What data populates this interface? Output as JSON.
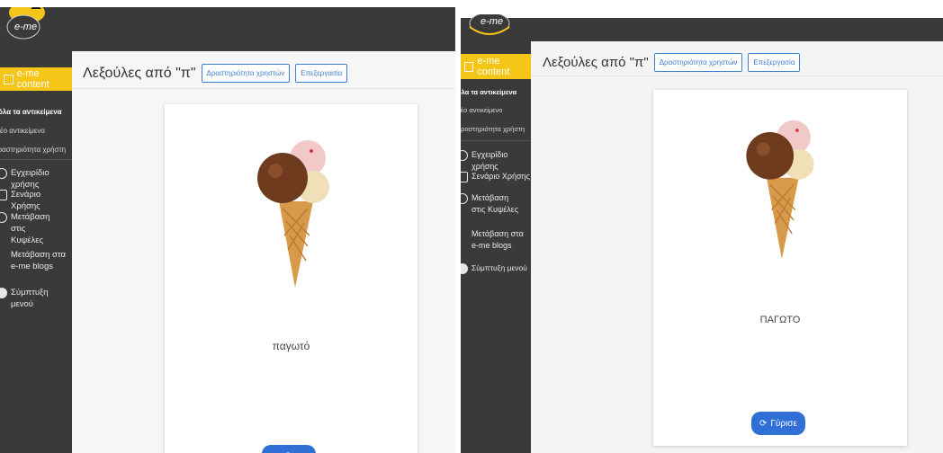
{
  "app": {
    "logo_text": "e-me"
  },
  "sidebar": {
    "header": "e-me content",
    "subitems": [
      "όλα τα αντικείμενα",
      "νέο αντικείμενο",
      "δραστηριότητα χρήστη"
    ],
    "items": [
      {
        "label": "Εγχειρίδιο χρήσης",
        "icon": "help-circle-icon"
      },
      {
        "label": "Σενάριο Χρήσης",
        "icon": "document-icon"
      },
      {
        "label": "Μετάβαση στις Κυψέλες",
        "icon": "hive-icon"
      },
      {
        "label": "Μετάβαση στα e-me blogs",
        "icon": "blog-icon"
      },
      {
        "label": "Σύμπτυξη μενού",
        "icon": "collapse-icon"
      }
    ]
  },
  "header": {
    "title": "Λεξούλες από \"π\"",
    "activity_button": "Δραστηριότητα χρηστών",
    "edit_button": "Επεξεργασία"
  },
  "flashcard_front": {
    "word": "παγωτό"
  },
  "flashcard_back": {
    "word": "ΠΑΓΩΤΟ",
    "flip_button": "Γύρισε"
  },
  "colors": {
    "accent": "#f5c518",
    "topbar": "#3a3a3a",
    "button": "#2f6fd6"
  }
}
